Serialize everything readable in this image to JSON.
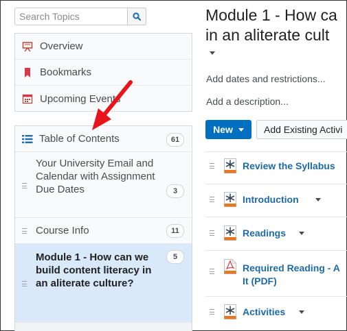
{
  "search": {
    "placeholder": "Search Topics",
    "icon": "search-icon"
  },
  "nav": {
    "items": [
      {
        "label": "Overview",
        "icon": "overview-icon"
      },
      {
        "label": "Bookmarks",
        "icon": "bookmark-icon"
      },
      {
        "label": "Upcoming Events",
        "icon": "calendar-icon"
      }
    ]
  },
  "toc": {
    "label": "Table of Contents",
    "count": "61",
    "modules": [
      {
        "label": "Your University Email and Calendar with Assignment Due Dates",
        "count": "3"
      },
      {
        "label": "Course Info",
        "count": "11"
      },
      {
        "label": "Module 1 -  How can we build content literacy in an aliterate culture?",
        "count": "5"
      }
    ]
  },
  "main": {
    "title_line1": "Module 1 - How ca",
    "title_line2": "in an aliterate cult",
    "add_dates": "Add dates and restrictions...",
    "add_description": "Add a description...",
    "new_button": "New",
    "add_existing_button": "Add Existing Activi",
    "topics": [
      {
        "label": "Review the Syllabus",
        "icon": "activity-icon"
      },
      {
        "label": "Introduction",
        "icon": "activity-icon"
      },
      {
        "label": "Readings",
        "icon": "activity-icon"
      },
      {
        "label_line1": "Required Reading - A",
        "label_line2": "It (PDF)",
        "icon": "pdf-icon"
      },
      {
        "label": "Activities",
        "icon": "activity-icon"
      }
    ]
  },
  "colors": {
    "accent": "#006fbf",
    "link": "#1d6aa8",
    "active_row": "#d9e9f9",
    "annotation_arrow": "#e8141b"
  }
}
